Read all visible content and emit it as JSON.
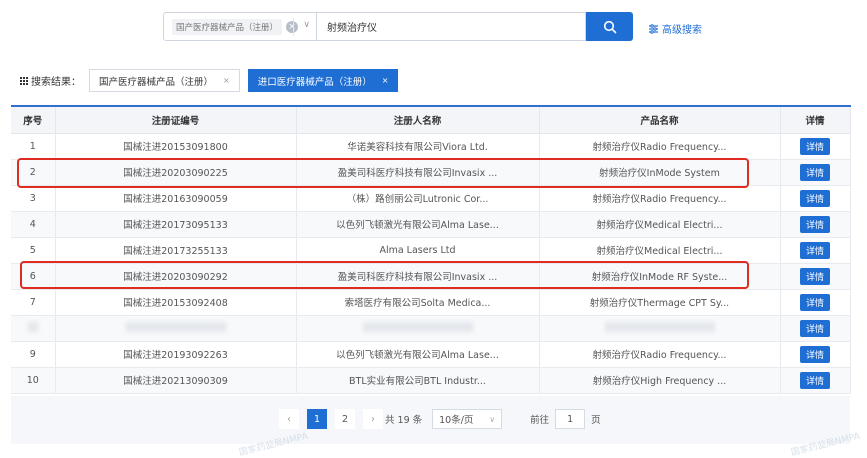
{
  "search": {
    "category_tag": "国产医疗器械产品（注册）",
    "clear_symbol": "×",
    "dropdown_symbol": "∨",
    "keyword_value": "射频治疗仪",
    "advanced_label": "高级搜索"
  },
  "results": {
    "label": "搜索结果：",
    "tags": [
      {
        "label": "国产医疗器械产品（注册）",
        "active": false,
        "close": "×"
      },
      {
        "label": "进口医疗器械产品（注册）",
        "active": true,
        "close": "×"
      }
    ]
  },
  "table": {
    "headers": [
      "序号",
      "注册证编号",
      "注册人名称",
      "产品名称",
      "详情"
    ],
    "detail_label": "详情",
    "rows": [
      {
        "no": "1",
        "reg": "国械注进20153091800",
        "owner": "华诺美容科技有限公司Viora Ltd.",
        "product": "射频治疗仪Radio Frequency...",
        "redacted": false,
        "highlighted": false
      },
      {
        "no": "2",
        "reg": "国械注进20203090225",
        "owner": "盈美司科医疗科技有限公司Invasix ...",
        "product": "射频治疗仪InMode System",
        "redacted": false,
        "highlighted": true
      },
      {
        "no": "3",
        "reg": "国械注进20163090059",
        "owner": "（株）路创丽公司Lutronic Cor...",
        "product": "射频治疗仪Radio Frequency...",
        "redacted": false,
        "highlighted": false
      },
      {
        "no": "4",
        "reg": "国械注进20173095133",
        "owner": "以色列飞顿激光有限公司Alma Lase...",
        "product": "射频治疗仪Medical Electri...",
        "redacted": false,
        "highlighted": false
      },
      {
        "no": "5",
        "reg": "国械注进20173255133",
        "owner": "Alma Lasers Ltd",
        "product": "射频治疗仪Medical Electri...",
        "redacted": false,
        "highlighted": false
      },
      {
        "no": "6",
        "reg": "国械注进20203090292",
        "owner": "盈美司科医疗科技有限公司Invasix ...",
        "product": "射频治疗仪InMode RF Syste...",
        "redacted": false,
        "highlighted": true
      },
      {
        "no": "7",
        "reg": "国械注进20153092408",
        "owner": "索塔医疗有限公司Solta Medica...",
        "product": "射频治疗仪Thermage CPT Sy...",
        "redacted": false,
        "highlighted": false
      },
      {
        "no": "",
        "reg": "",
        "owner": "",
        "product": "",
        "redacted": true,
        "highlighted": false
      },
      {
        "no": "9",
        "reg": "国械注进20193092263",
        "owner": "以色列飞顿激光有限公司Alma Lase...",
        "product": "射频治疗仪Radio Frequency...",
        "redacted": false,
        "highlighted": false
      },
      {
        "no": "10",
        "reg": "国械注进20213090309",
        "owner": "BTL实业有限公司BTL Industr...",
        "product": "射频治疗仪High Frequency ...",
        "redacted": false,
        "highlighted": false
      }
    ]
  },
  "pagination": {
    "prev": "‹",
    "pages": [
      "1",
      "2"
    ],
    "current": "1",
    "next": "›",
    "total": "共 19 条",
    "page_size": "10条/页",
    "goto_label": "前往",
    "goto_value": "1",
    "page_unit": "页"
  },
  "watermark": "国家药监局NMPA",
  "colors": {
    "accent": "#1f6ed4",
    "highlight": "#e02b20"
  }
}
